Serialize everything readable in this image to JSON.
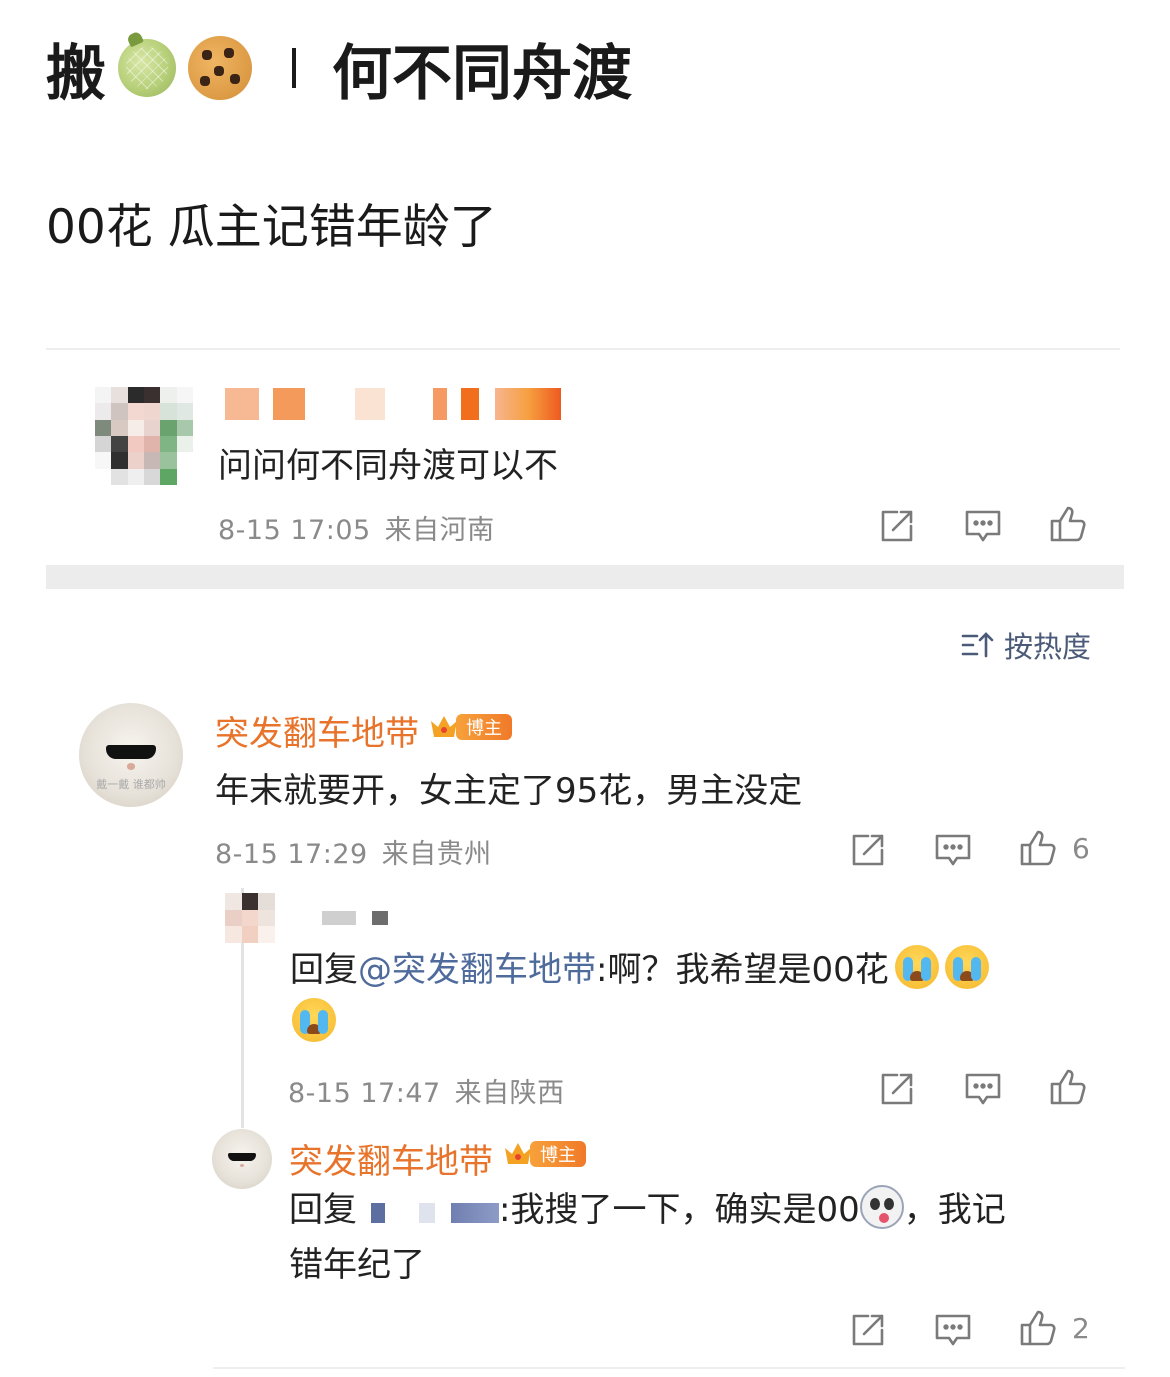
{
  "post": {
    "title_prefix": "搬",
    "title": "何不同舟渡",
    "body": "00花 瓜主记错年龄了"
  },
  "top_comment": {
    "text": "问问何不同舟渡可以不",
    "time": "8-15 17:05",
    "location": "来自河南"
  },
  "sort": {
    "label": "按热度"
  },
  "comments": [
    {
      "user": "突发翻车地带",
      "badge": "博主",
      "text": "年末就要开，女主定了95花，男主没定",
      "time": "8-15 17:29",
      "location": "来自贵州",
      "likes": "6",
      "replies": [
        {
          "reply_prefix": "回复",
          "mention": "@突发翻车地带",
          "text_line1": ":啊？我希望是00花",
          "time": "8-15 17:47",
          "location": "来自陕西"
        },
        {
          "user": "突发翻车地带",
          "badge": "博主",
          "reply_prefix": "回复",
          "text_line1_after": ":我搜了一下，确实是00",
          "text_line1_tail": "，我记",
          "text_line2": "错年纪了",
          "likes": "2"
        }
      ]
    }
  ],
  "icons": [
    "share-icon",
    "comment-icon",
    "like-icon",
    "sort-icon",
    "cry-emoji",
    "panda-emoji",
    "melon-emoji",
    "cookie-emoji",
    "crown-icon"
  ],
  "colors": {
    "username": "#e8732a",
    "mention": "#4e6b9c",
    "meta": "#8a8a8a",
    "badge": "#f07a2a"
  }
}
